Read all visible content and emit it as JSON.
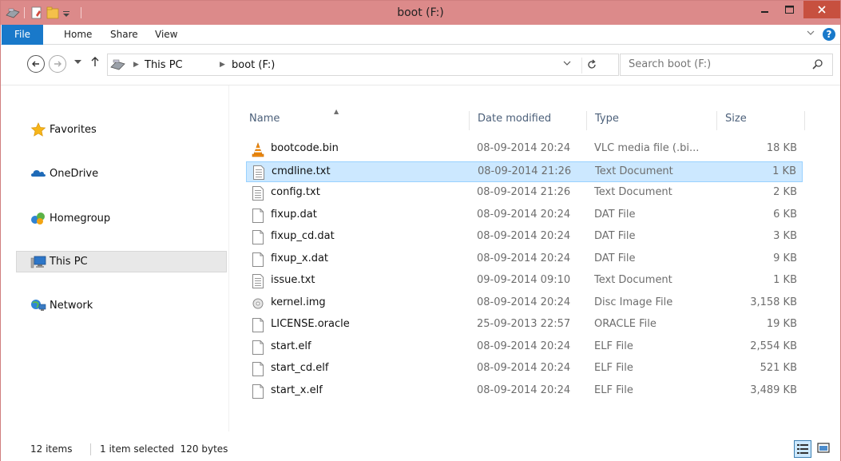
{
  "window": {
    "title": "boot (F:)"
  },
  "ribbon": {
    "tabs": [
      {
        "label": "File"
      },
      {
        "label": "Home"
      },
      {
        "label": "Share"
      },
      {
        "label": "View"
      }
    ],
    "help_label": "?"
  },
  "nav": {
    "breadcrumb": [
      "This PC",
      "boot (F:)"
    ],
    "search_placeholder": "Search boot (F:)"
  },
  "sidebar": {
    "items": [
      {
        "label": "Favorites",
        "icon": "star-icon"
      },
      {
        "label": "OneDrive",
        "icon": "cloud-icon"
      },
      {
        "label": "Homegroup",
        "icon": "homegroup-icon"
      },
      {
        "label": "This PC",
        "icon": "computer-icon",
        "selected": true
      },
      {
        "label": "Network",
        "icon": "network-icon"
      }
    ]
  },
  "filelist": {
    "columns": {
      "name": "Name",
      "date": "Date modified",
      "type": "Type",
      "size": "Size"
    },
    "rows": [
      {
        "name": "bootcode.bin",
        "date": "08-09-2014 20:24",
        "type": "VLC media file (.bi...",
        "size": "18 KB",
        "icon": "vlc-icon"
      },
      {
        "name": "cmdline.txt",
        "date": "08-09-2014 21:26",
        "type": "Text Document",
        "size": "1 KB",
        "icon": "text-file-icon",
        "selected": true
      },
      {
        "name": "config.txt",
        "date": "08-09-2014 21:26",
        "type": "Text Document",
        "size": "2 KB",
        "icon": "text-file-icon"
      },
      {
        "name": "fixup.dat",
        "date": "08-09-2014 20:24",
        "type": "DAT File",
        "size": "6 KB",
        "icon": "file-icon"
      },
      {
        "name": "fixup_cd.dat",
        "date": "08-09-2014 20:24",
        "type": "DAT File",
        "size": "3 KB",
        "icon": "file-icon"
      },
      {
        "name": "fixup_x.dat",
        "date": "08-09-2014 20:24",
        "type": "DAT File",
        "size": "9 KB",
        "icon": "file-icon"
      },
      {
        "name": "issue.txt",
        "date": "09-09-2014 09:10",
        "type": "Text Document",
        "size": "1 KB",
        "icon": "text-file-icon"
      },
      {
        "name": "kernel.img",
        "date": "08-09-2014 20:24",
        "type": "Disc Image File",
        "size": "3,158 KB",
        "icon": "disc-image-icon"
      },
      {
        "name": "LICENSE.oracle",
        "date": "25-09-2013 22:57",
        "type": "ORACLE File",
        "size": "19 KB",
        "icon": "file-icon"
      },
      {
        "name": "start.elf",
        "date": "08-09-2014 20:24",
        "type": "ELF File",
        "size": "2,554 KB",
        "icon": "file-icon"
      },
      {
        "name": "start_cd.elf",
        "date": "08-09-2014 20:24",
        "type": "ELF File",
        "size": "521 KB",
        "icon": "file-icon"
      },
      {
        "name": "start_x.elf",
        "date": "08-09-2014 20:24",
        "type": "ELF File",
        "size": "3,489 KB",
        "icon": "file-icon"
      }
    ]
  },
  "status": {
    "item_count": "12 items",
    "selection": "1 item selected  120 bytes"
  },
  "colors": {
    "titlebar": "#dc8a8a",
    "close_button": "#c7503f",
    "file_tab": "#1979ca",
    "selection": "#cce8ff",
    "selection_border": "#99d1ff"
  }
}
